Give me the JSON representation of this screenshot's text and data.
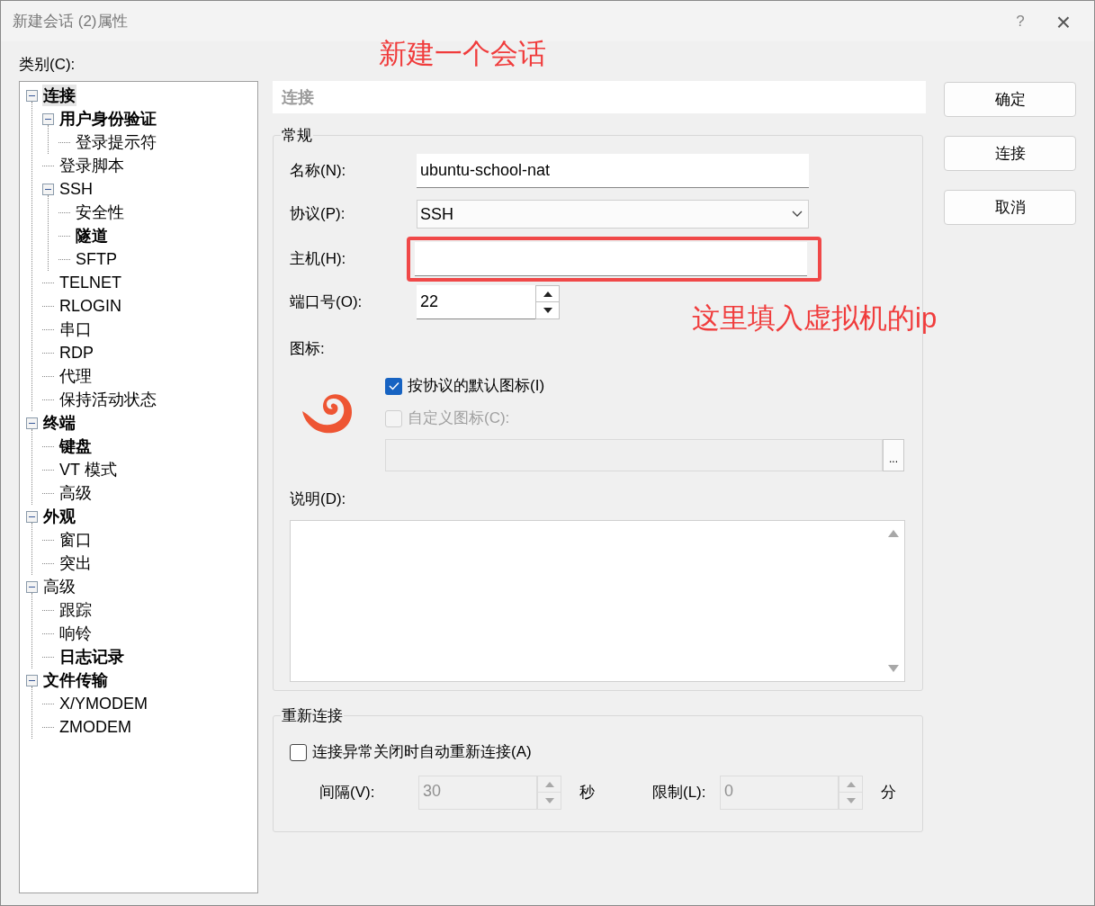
{
  "window": {
    "title": "新建会话 (2)属性",
    "help": "?",
    "close": "×"
  },
  "annotations": [
    {
      "kind": "text",
      "text": "新建一个会话"
    },
    {
      "kind": "text",
      "text": "这里填入虚拟机的ip"
    }
  ],
  "category_label": "类别(C):",
  "tree": [
    {
      "label": "连接",
      "bold": true,
      "selected": true,
      "expanded": true,
      "children": [
        {
          "label": "用户身份验证",
          "bold": true,
          "selected": false,
          "expanded": true,
          "children": [
            {
              "label": "登录提示符",
              "bold": false,
              "selected": false
            }
          ]
        },
        {
          "label": "登录脚本",
          "bold": false,
          "selected": false
        },
        {
          "label": "SSH",
          "bold": false,
          "selected": false,
          "expanded": true,
          "children": [
            {
              "label": "安全性",
              "bold": false,
              "selected": false
            },
            {
              "label": "隧道",
              "bold": true,
              "selected": false
            },
            {
              "label": "SFTP",
              "bold": false,
              "selected": false
            }
          ]
        },
        {
          "label": "TELNET",
          "bold": false,
          "selected": false
        },
        {
          "label": "RLOGIN",
          "bold": false,
          "selected": false
        },
        {
          "label": "串口",
          "bold": false,
          "selected": false
        },
        {
          "label": "RDP",
          "bold": false,
          "selected": false
        },
        {
          "label": "代理",
          "bold": false,
          "selected": false
        },
        {
          "label": "保持活动状态",
          "bold": false,
          "selected": false
        }
      ]
    },
    {
      "label": "终端",
      "bold": true,
      "selected": false,
      "expanded": true,
      "children": [
        {
          "label": "键盘",
          "bold": true,
          "selected": false
        },
        {
          "label": "VT 模式",
          "bold": false,
          "selected": false
        },
        {
          "label": "高级",
          "bold": false,
          "selected": false
        }
      ]
    },
    {
      "label": "外观",
      "bold": true,
      "selected": false,
      "expanded": true,
      "children": [
        {
          "label": "窗口",
          "bold": false,
          "selected": false
        },
        {
          "label": "突出",
          "bold": false,
          "selected": false
        }
      ]
    },
    {
      "label": "高级",
      "bold": false,
      "selected": false,
      "expanded": true,
      "children": [
        {
          "label": "跟踪",
          "bold": false,
          "selected": false
        },
        {
          "label": "响铃",
          "bold": false,
          "selected": false
        },
        {
          "label": "日志记录",
          "bold": true,
          "selected": false
        }
      ]
    },
    {
      "label": "文件传输",
      "bold": true,
      "selected": false,
      "expanded": true,
      "children": [
        {
          "label": "X/YMODEM",
          "bold": false,
          "selected": false
        },
        {
          "label": "ZMODEM",
          "bold": false,
          "selected": false
        }
      ]
    }
  ],
  "panel_header": "连接",
  "general": {
    "title": "常规",
    "name": {
      "label": "名称(N):",
      "value": "ubuntu-school-nat"
    },
    "protocol": {
      "label": "协议(P):",
      "value": "SSH"
    },
    "host": {
      "label": "主机(H):",
      "highlighted": true
    },
    "port": {
      "label": "端口号(O):",
      "value": "22"
    },
    "icon_label": "图标:",
    "default_icon": {
      "label": "按协议的默认图标(I)",
      "checked": true,
      "disabled": false
    },
    "custom_icon": {
      "label": "自定义图标(C):",
      "checked": false,
      "disabled": true
    },
    "browse": "...",
    "description_label": "说明(D):"
  },
  "reconnect": {
    "title": "重新连接",
    "auto": {
      "label": "连接异常关闭时自动重新连接(A)",
      "checked": false,
      "disabled": false
    },
    "interval": {
      "label": "间隔(V):",
      "value": "30",
      "unit": "秒",
      "disabled": true
    },
    "limit": {
      "label": "限制(L):",
      "value": "0",
      "unit": "分",
      "disabled": true
    }
  },
  "buttons": [
    "确定",
    "连接",
    "取消"
  ]
}
